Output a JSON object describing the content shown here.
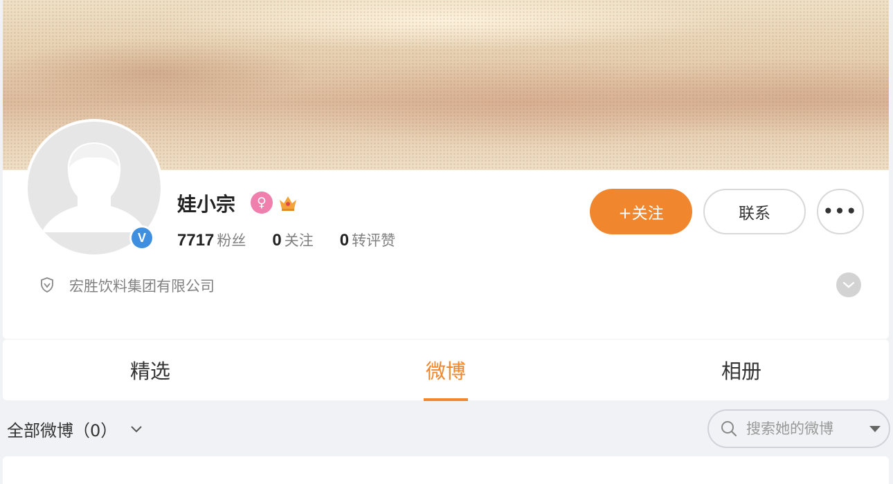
{
  "profile": {
    "name": "娃小宗",
    "gender_icon": "female-icon",
    "vip_icon": "crown-icon",
    "verified_badge": "V",
    "stats": [
      {
        "num": "7717",
        "label": "粉丝"
      },
      {
        "num": "0",
        "label": "关注"
      },
      {
        "num": "0",
        "label": "转评赞"
      }
    ],
    "company": "宏胜饮料集团有限公司"
  },
  "actions": {
    "follow": "+关注",
    "contact": "联系",
    "more": "•••"
  },
  "tabs": [
    {
      "label": "精选",
      "active": false
    },
    {
      "label": "微博",
      "active": true
    },
    {
      "label": "相册",
      "active": false
    }
  ],
  "filter": {
    "label": "全部微博（0）"
  },
  "search": {
    "placeholder": "搜索她的微博"
  },
  "colors": {
    "accent": "#f0872e",
    "verified": "#3e8fe0",
    "female": "#f07fae"
  }
}
